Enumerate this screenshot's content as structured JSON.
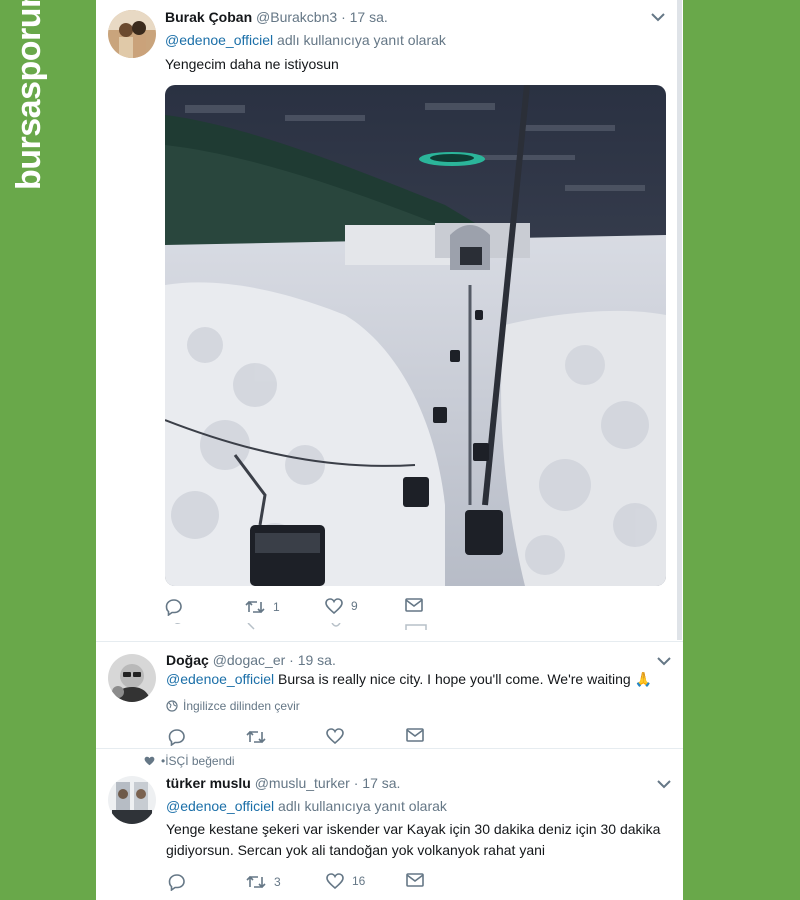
{
  "brand": {
    "name": "bursasporum"
  },
  "tweets": [
    {
      "name": "Burak Çoban",
      "handle": "@Burakcbn3",
      "time": "· 17 sa.",
      "reply_mention": "@edenoe_officiel",
      "reply_suffix": "adlı kullanıcıya yanıt olarak",
      "text": "Yengecim daha ne istiyosun",
      "retweets": "1",
      "likes": "9"
    },
    {
      "name": "Doğaç",
      "handle": "@dogac_er",
      "time": "· 19 sa.",
      "mention": "@edenoe_officiel",
      "text": "Bursa is really nice city. I hope you'll come. We're waiting",
      "emoji": "🙏",
      "translate": "İngilizce dilinden çevir"
    },
    {
      "liked_by": "•İSÇİ beğendi",
      "name": "türker muslu",
      "handle": "@muslu_turker",
      "time": "· 17 sa.",
      "reply_mention": "@edenoe_officiel",
      "reply_suffix": "adlı kullanıcıya yanıt olarak",
      "text_line1": "Yenge kestane şekeri var iskender var Kayak için 30 dakika deniz için 30 dakika",
      "text_line2": "gidiyorsun. Sercan yok ali tandoğan yok volkanyok rahat yani",
      "retweets": "3",
      "likes": "16"
    }
  ],
  "colors": {
    "accent": "#1b6fa8",
    "muted": "#657786",
    "green": "#69a84a"
  }
}
